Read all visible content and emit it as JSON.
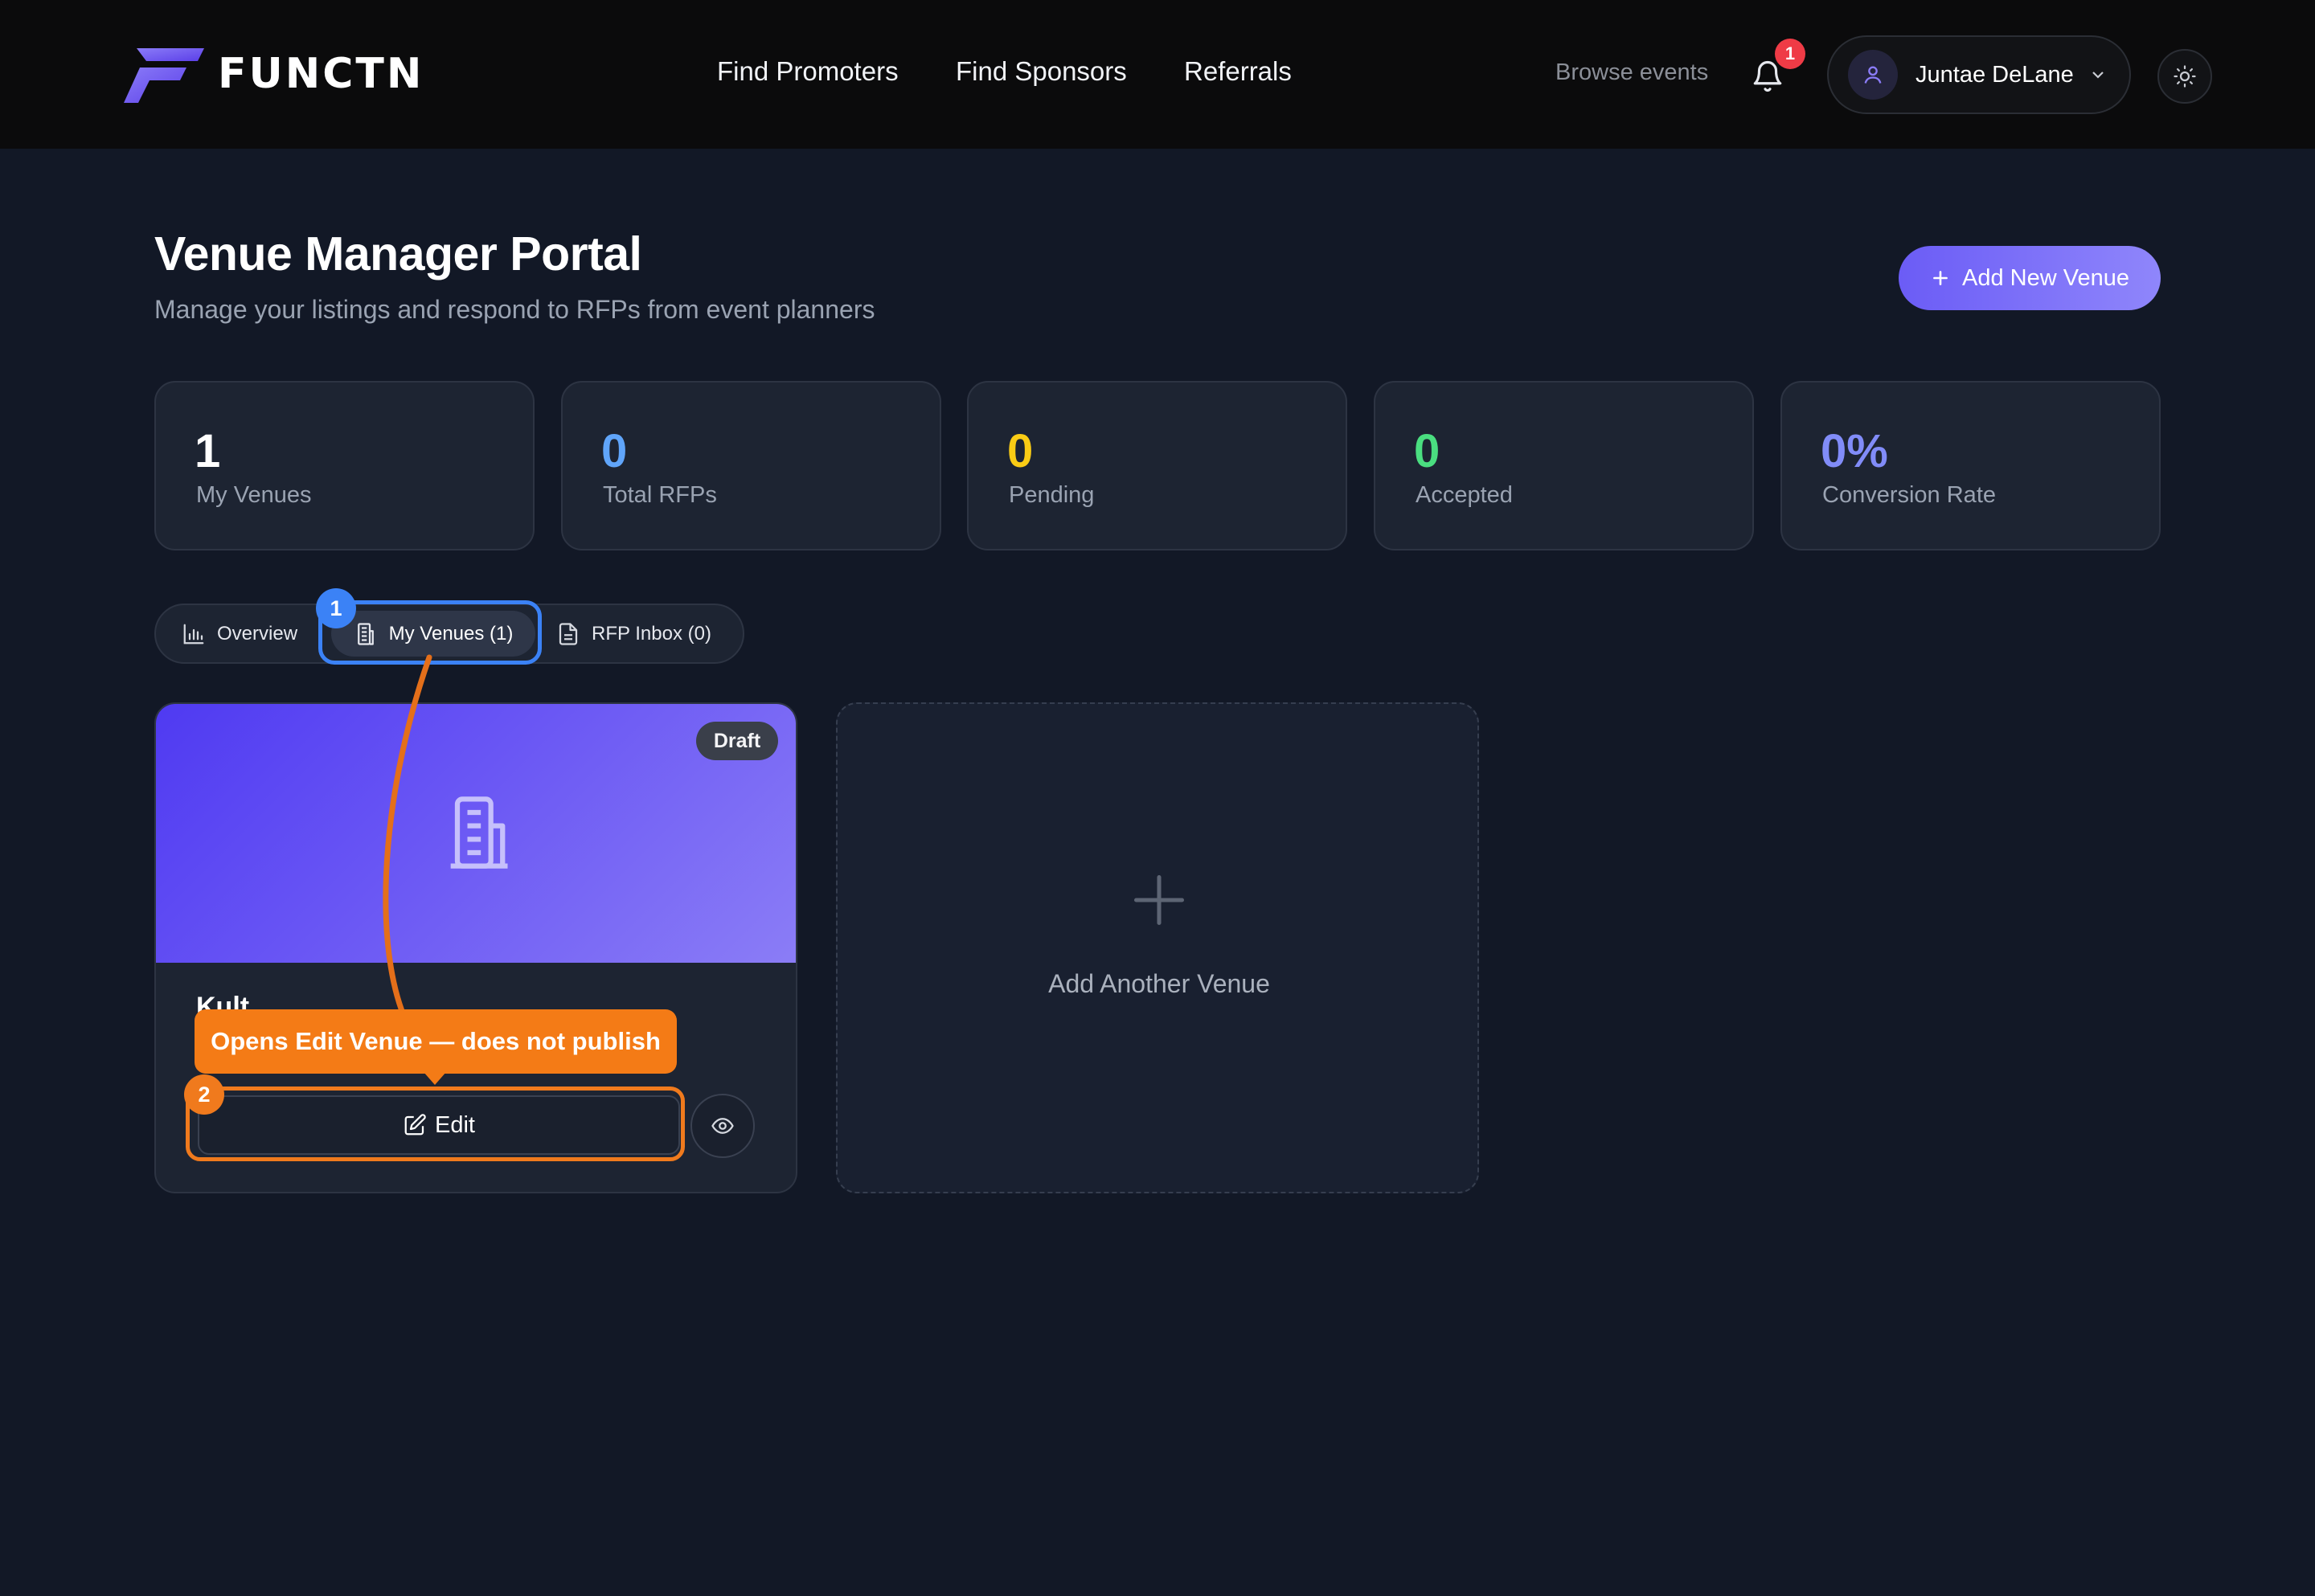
{
  "brand": {
    "name": "FUNCTN",
    "accent": "#6b5cf6"
  },
  "nav": {
    "links": [
      "Find Promoters",
      "Find Sponsors",
      "Referrals"
    ],
    "browse": "Browse events",
    "notification_count": "1",
    "user_name": "Juntae DeLane"
  },
  "header": {
    "title": "Venue Manager Portal",
    "subtitle": "Manage your listings and respond to RFPs from event planners",
    "add_button": "Add New Venue"
  },
  "stats": [
    {
      "value": "1",
      "label": "My Venues",
      "color": "#ffffff"
    },
    {
      "value": "0",
      "label": "Total RFPs",
      "color": "#60a5fa"
    },
    {
      "value": "0",
      "label": "Pending",
      "color": "#facc15"
    },
    {
      "value": "0",
      "label": "Accepted",
      "color": "#4ade80"
    },
    {
      "value": "0%",
      "label": "Conversion Rate",
      "color": "#818cf8"
    }
  ],
  "tabs": [
    {
      "label": "Overview",
      "icon": "bar-chart-icon",
      "active": false
    },
    {
      "label": "My Venues (1)",
      "icon": "building-icon",
      "active": true
    },
    {
      "label": "RFP Inbox (0)",
      "icon": "document-icon",
      "active": false
    }
  ],
  "venue_card": {
    "status": "Draft",
    "name": "Kult",
    "edit_label": "Edit"
  },
  "add_another": {
    "label": "Add Another Venue"
  },
  "annotations": {
    "step1": "1",
    "step2": "2",
    "tooltip": "Opens Edit Venue — does not publish",
    "step1_color": "#3b82f6",
    "step2_color": "#f07a1d"
  }
}
